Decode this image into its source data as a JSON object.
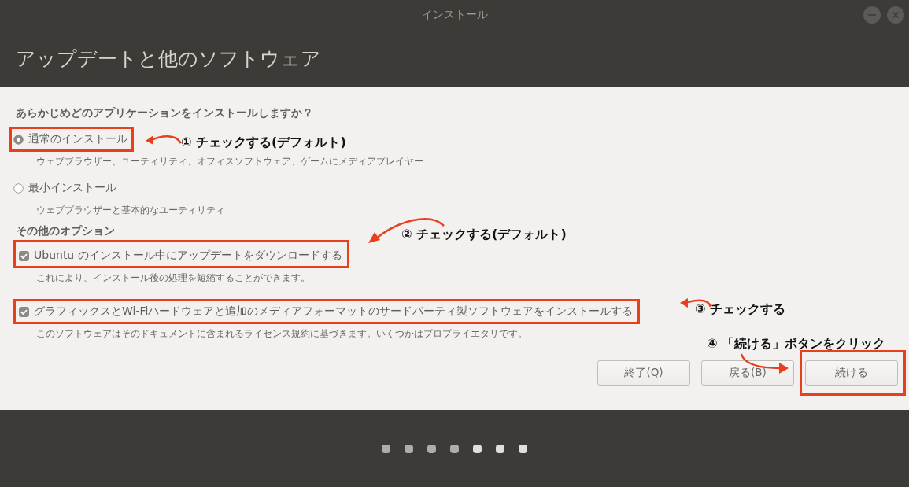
{
  "window": {
    "title": "インストール"
  },
  "header": {
    "title": "アップデートと他のソフトウェア"
  },
  "question": "あらかじめどのアプリケーションをインストールしますか？",
  "install_types": [
    {
      "label": "通常のインストール",
      "description": "ウェブブラウザー、ユーティリティ、オフィスソフトウェア、ゲームにメディアプレイヤー",
      "selected": true,
      "highlighted": true
    },
    {
      "label": "最小インストール",
      "description": "ウェブブラウザーと基本的なユーティリティ",
      "selected": false,
      "highlighted": false
    }
  ],
  "other_options": {
    "title": "その他のオプション",
    "items": [
      {
        "label": "Ubuntu のインストール中にアップデートをダウンロードする",
        "description": "これにより、インストール後の処理を短縮することができます。",
        "checked": true,
        "highlighted": true
      },
      {
        "label": "グラフィックスとWi-Fiハードウェアと追加のメディアフォーマットのサードパーティ製ソフトウェアをインストールする",
        "description": "このソフトウェアはそのドキュメントに含まれるライセンス規約に基づきます。いくつかはプロプライエタリです。",
        "checked": true,
        "highlighted": true
      }
    ]
  },
  "buttons": [
    {
      "label": "終了(Q)",
      "highlighted": false
    },
    {
      "label": "戻る(B)",
      "highlighted": false
    },
    {
      "label": "続ける",
      "highlighted": true
    }
  ],
  "callouts": [
    "① チェックする(デフォルト)",
    "② チェックする(デフォルト)",
    "③ チェックする",
    "④ 「続ける」ボタンをクリック"
  ],
  "progress_steps": [
    {
      "completed": true
    },
    {
      "completed": true
    },
    {
      "completed": true
    },
    {
      "completed": true
    },
    {
      "completed": false
    },
    {
      "completed": false
    },
    {
      "completed": false
    }
  ]
}
